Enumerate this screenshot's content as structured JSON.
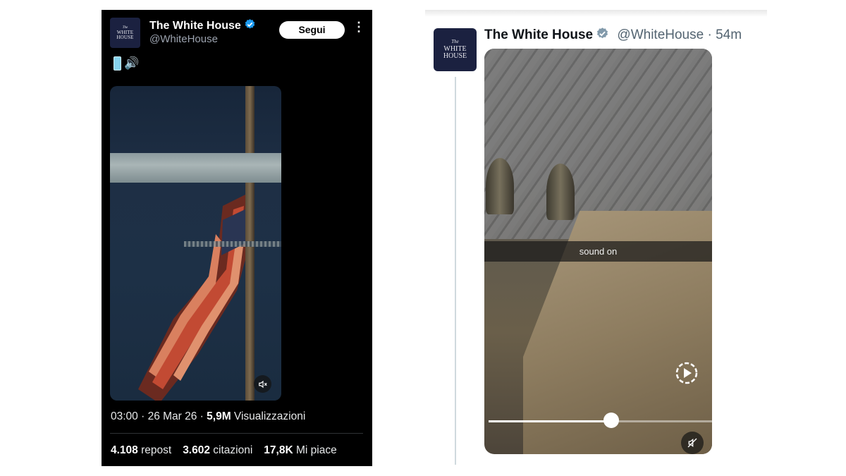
{
  "left_post": {
    "author_name": "The White House",
    "handle": "@WhiteHouse",
    "follow_label": "Segui",
    "more_label": "⋮",
    "emoji_speaker": "🔊",
    "avatar_lines": [
      "The",
      "WHITE",
      "HOUSE"
    ],
    "meta": {
      "time": "03:00",
      "sep1": " · ",
      "date": "26 Mar 26",
      "sep2": " · ",
      "views_count": "5,9M",
      "views_label": " Visualizzazioni"
    },
    "stats": {
      "reposts_count": "4.108",
      "reposts_label": " repost",
      "quotes_count": "3.602",
      "quotes_label": " citazioni",
      "likes_count": "17,8K",
      "likes_label": " Mi piace"
    }
  },
  "right_post": {
    "author_name": "The White House",
    "handle": "@WhiteHouse",
    "time_sep": " · ",
    "time_ago": "54m",
    "avatar_lines": [
      "The",
      "WHITE",
      "HOUSE"
    ],
    "video_caption": "sound on",
    "progress_fraction": 0.55
  },
  "colors": {
    "verified_blue": "#1d9bf0",
    "verified_gray": "#829aab",
    "avatar_navy": "#1b2140"
  },
  "icons": {
    "left_volume": "mute-icon",
    "right_replay": "replay-icon",
    "right_volume": "mute-icon",
    "verified": "verified-badge-icon"
  }
}
